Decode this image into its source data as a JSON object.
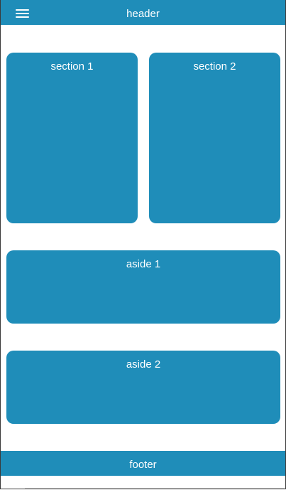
{
  "header": {
    "title": "header",
    "menu_icon": "hamburger-menu-icon"
  },
  "sections": [
    {
      "label": "section 1"
    },
    {
      "label": "section 2"
    }
  ],
  "asides": [
    {
      "label": "aside 1"
    },
    {
      "label": "aside 2"
    }
  ],
  "footer": {
    "label": "footer"
  },
  "colors": {
    "primary": "#1f8db9",
    "text": "#ffffff",
    "background": "#ffffff"
  }
}
